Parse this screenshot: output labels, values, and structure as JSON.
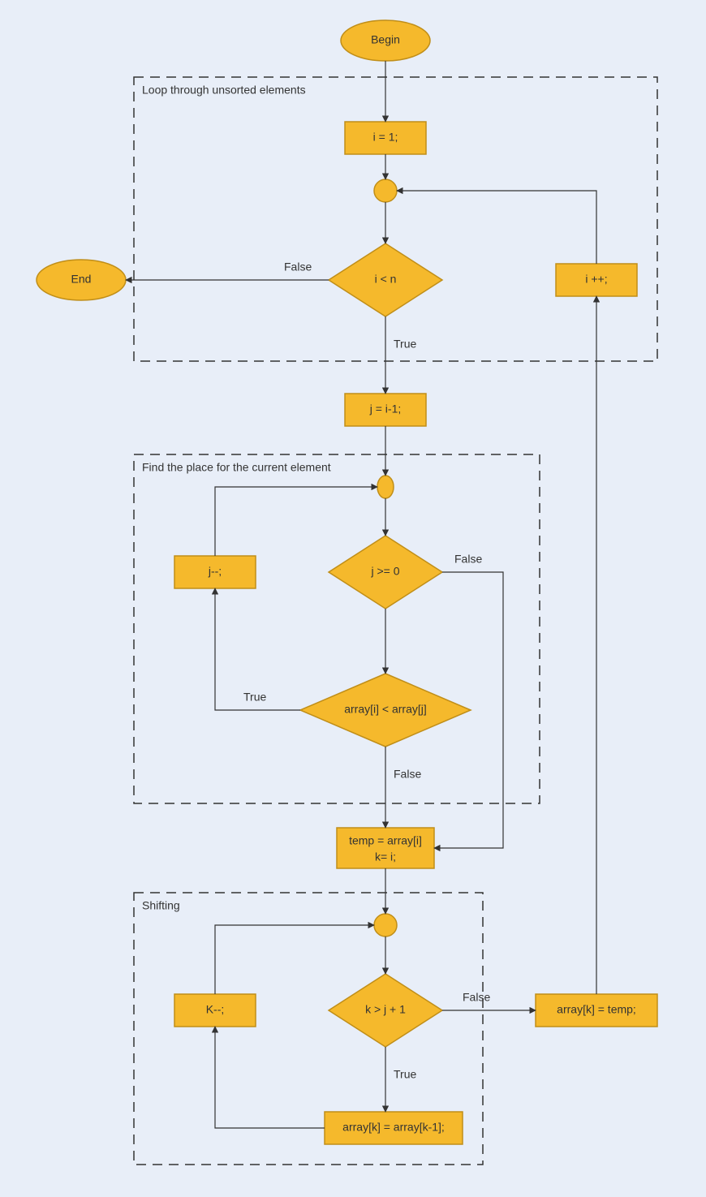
{
  "nodes": {
    "begin": "Begin",
    "end": "End",
    "i_init": "i = 1;",
    "i_cond": "i < n",
    "i_inc": "i ++;",
    "j_init": "j = i-1;",
    "j_dec": "j--;",
    "j_cond": "j >= 0",
    "arr_cond": "array[i] < array[j]",
    "temp_l1": "temp = array[i]",
    "temp_l2": "k= i;",
    "k_dec": "K--;",
    "k_cond": "k > j + 1",
    "arr_assign": "array[k] = temp;",
    "shift_stmt": "array[k] = array[k-1];"
  },
  "groups": {
    "outer": "Loop through unsorted elements",
    "find": "Find the place for the current element",
    "shift": "Shifting"
  },
  "edges": {
    "true": "True",
    "false": "False"
  }
}
